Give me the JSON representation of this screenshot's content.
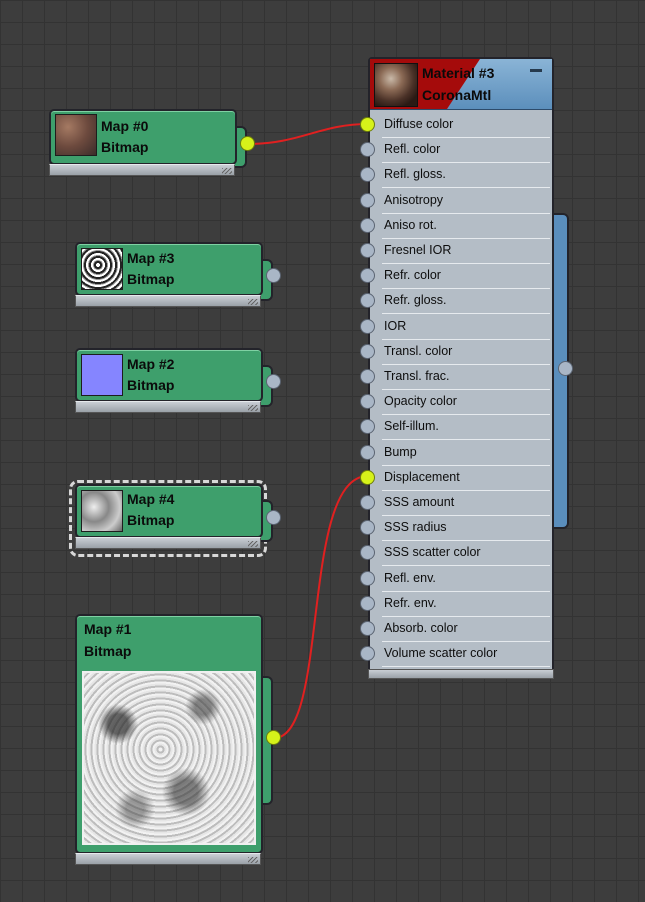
{
  "material": {
    "title": "Material #3",
    "type": "CoronaMtl",
    "slots": [
      {
        "label": "Diffuse color",
        "connected": true
      },
      {
        "label": "Refl. color",
        "connected": false
      },
      {
        "label": "Refl. gloss.",
        "connected": false
      },
      {
        "label": "Anisotropy",
        "connected": false
      },
      {
        "label": "Aniso rot.",
        "connected": false
      },
      {
        "label": "Fresnel IOR",
        "connected": false
      },
      {
        "label": "Refr. color",
        "connected": false
      },
      {
        "label": "Refr. gloss.",
        "connected": false
      },
      {
        "label": "IOR",
        "connected": false
      },
      {
        "label": "Transl. color",
        "connected": false
      },
      {
        "label": "Transl. frac.",
        "connected": false
      },
      {
        "label": "Opacity color",
        "connected": false
      },
      {
        "label": "Self-illum.",
        "connected": false
      },
      {
        "label": "Bump",
        "connected": false
      },
      {
        "label": "Displacement",
        "connected": true
      },
      {
        "label": "SSS amount",
        "connected": false
      },
      {
        "label": "SSS radius",
        "connected": false
      },
      {
        "label": "SSS scatter color",
        "connected": false
      },
      {
        "label": "Refl. env.",
        "connected": false
      },
      {
        "label": "Refr. env.",
        "connected": false
      },
      {
        "label": "Absorb. color",
        "connected": false
      },
      {
        "label": "Volume scatter color",
        "connected": false
      }
    ]
  },
  "maps": [
    {
      "name": "Map #0",
      "type": "Bitmap",
      "connected": true,
      "selected": false
    },
    {
      "name": "Map #3",
      "type": "Bitmap",
      "connected": false,
      "selected": false
    },
    {
      "name": "Map #2",
      "type": "Bitmap",
      "connected": false,
      "selected": false,
      "swatch": "#8585ff"
    },
    {
      "name": "Map #4",
      "type": "Bitmap",
      "connected": false,
      "selected": true
    },
    {
      "name": "Map #1",
      "type": "Bitmap",
      "connected": true,
      "selected": false
    }
  ],
  "colors": {
    "map_node": "#3e9f6c",
    "material_header": "#5c8fbc",
    "material_body": "#b4bdc6",
    "wire": "#e02020",
    "socket_connected": "#d6f21a",
    "socket_free": "#a9b6c6"
  }
}
